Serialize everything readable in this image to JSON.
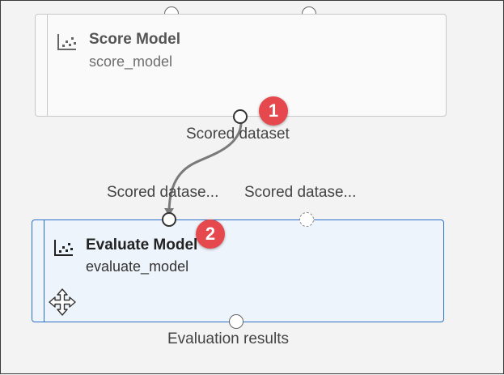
{
  "score_node": {
    "title": "Score Model",
    "subtitle": "score_model",
    "output_label": "Scored dataset"
  },
  "evaluate_node": {
    "title": "Evaluate Model",
    "subtitle": "evaluate_model",
    "input_labels": [
      "Scored datase...",
      "Scored datase..."
    ],
    "output_label": "Evaluation results"
  },
  "badges": [
    "1",
    "2"
  ],
  "icons": {
    "node_icon": "scatter-chart-icon",
    "move_icon": "move-arrows-icon"
  },
  "colors": {
    "badge": "#e5484d",
    "selected_border": "#2b6fc7",
    "selected_fill": "#eef4fb"
  }
}
